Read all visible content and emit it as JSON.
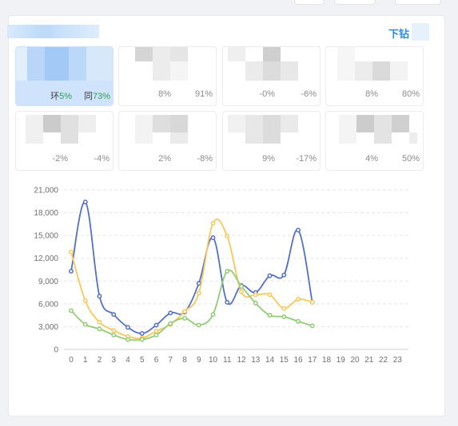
{
  "header": {
    "drill_label": "下钻"
  },
  "kpi_row1": [
    {
      "v1": "环5%",
      "v2": "同73%",
      "active": true,
      "p1": "环",
      "n1": "5%",
      "p2": "同",
      "n2": "73%"
    },
    {
      "v1": "8%",
      "v2": "91%"
    },
    {
      "v1": "-0%",
      "v2": "-6%"
    },
    {
      "v1": "8%",
      "v2": "80%"
    }
  ],
  "kpi_row2": [
    {
      "v1": "-2%",
      "v2": "-4%"
    },
    {
      "v1": "2%",
      "v2": "-8%"
    },
    {
      "v1": "9%",
      "v2": "-17%"
    },
    {
      "v1": "4%",
      "v2": "50%"
    }
  ],
  "colors": {
    "blue": "#5470c6",
    "yellow": "#fac858",
    "green": "#91cc75",
    "accent": "#2f8ae6"
  },
  "chart_data": {
    "type": "line",
    "categories": [
      0,
      1,
      2,
      3,
      4,
      5,
      6,
      7,
      8,
      9,
      10,
      11,
      12,
      13,
      14,
      15,
      16,
      17,
      18,
      19,
      20,
      21,
      22,
      23
    ],
    "ylim": [
      0,
      21000
    ],
    "yticks": [
      "0",
      "3,000",
      "6,000",
      "9,000",
      "12,000",
      "15,000",
      "18,000",
      "21,000"
    ],
    "grid": true,
    "series": [
      {
        "color": "#5470c6",
        "values": [
          10300,
          19400,
          7000,
          4600,
          2900,
          2100,
          3200,
          4800,
          4900,
          8700,
          14700,
          6200,
          8400,
          7500,
          9700,
          9800,
          15700,
          6200
        ]
      },
      {
        "color": "#fac858",
        "values": [
          12800,
          6400,
          3600,
          2500,
          1700,
          1500,
          2400,
          3300,
          5000,
          7400,
          16600,
          14900,
          7600,
          7200,
          7200,
          5400,
          6600,
          6200
        ]
      },
      {
        "color": "#91cc75",
        "values": [
          5100,
          3300,
          2700,
          1900,
          1300,
          1300,
          1900,
          3400,
          4100,
          3200,
          4600,
          10300,
          8300,
          6100,
          4500,
          4300,
          3700,
          3100
        ]
      }
    ]
  }
}
